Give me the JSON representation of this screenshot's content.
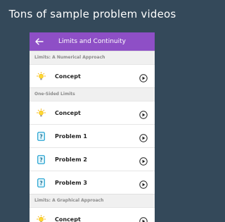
{
  "tagline": "Tons of sample problem videos",
  "app": {
    "title": "Limits and Continuity",
    "back_icon": "arrow-left-icon",
    "accent": "#8e4fc6",
    "background": "#34495a"
  },
  "sections": [
    {
      "header": "Limits: A Numerical Approach",
      "items": [
        {
          "label": "Concept",
          "icon": "lightbulb-icon"
        }
      ]
    },
    {
      "header": "One-Sided Limits",
      "items": [
        {
          "label": "Concept",
          "icon": "lightbulb-icon"
        },
        {
          "label": "Problem 1",
          "icon": "question-card-icon"
        },
        {
          "label": "Problem 2",
          "icon": "question-card-icon"
        },
        {
          "label": "Problem 3",
          "icon": "question-card-icon"
        }
      ]
    },
    {
      "header": "Limits: A Graphical Approach",
      "items": [
        {
          "label": "Concept",
          "icon": "lightbulb-icon"
        }
      ]
    }
  ]
}
